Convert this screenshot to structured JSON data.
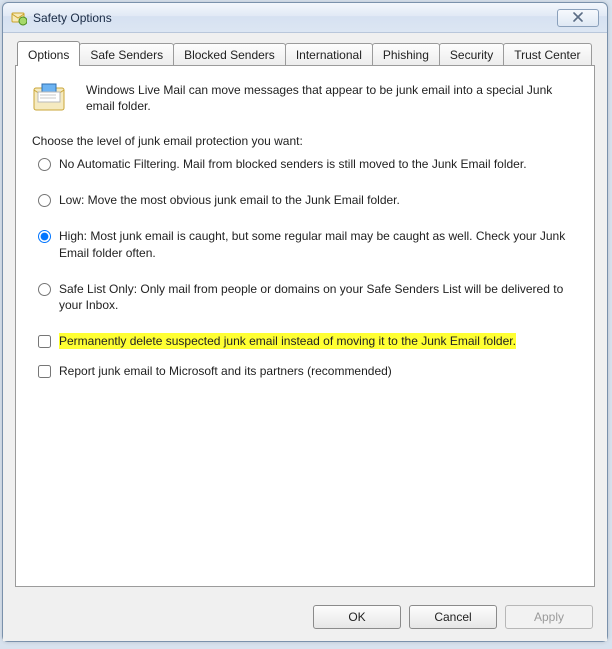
{
  "window": {
    "title": "Safety Options"
  },
  "tabs": {
    "items": [
      {
        "label": "Options"
      },
      {
        "label": "Safe Senders"
      },
      {
        "label": "Blocked Senders"
      },
      {
        "label": "International"
      },
      {
        "label": "Phishing"
      },
      {
        "label": "Security"
      },
      {
        "label": "Trust Center"
      }
    ],
    "active_index": 0
  },
  "panel": {
    "intro": "Windows Live Mail can move messages that appear to be junk email into a special Junk email folder.",
    "choose": "Choose the level of junk email protection you want:",
    "options": [
      {
        "label": "No Automatic Filtering.  Mail from blocked senders is still moved to the Junk Email folder."
      },
      {
        "label": "Low: Move the most obvious junk email to the Junk Email folder."
      },
      {
        "label": "High: Most junk email is caught, but some regular mail may be caught as well. Check your Junk Email folder often."
      },
      {
        "label": "Safe List Only: Only mail from people or domains on your Safe Senders List will be delivered to your Inbox."
      }
    ],
    "selected_index": 2,
    "perm_delete": {
      "label": "Permanently delete suspected junk email instead of moving it to the Junk Email folder.",
      "checked": false,
      "highlight": true
    },
    "report": {
      "label": "Report junk email to Microsoft and its partners (recommended)",
      "checked": false
    }
  },
  "buttons": {
    "ok": "OK",
    "cancel": "Cancel",
    "apply": "Apply"
  }
}
